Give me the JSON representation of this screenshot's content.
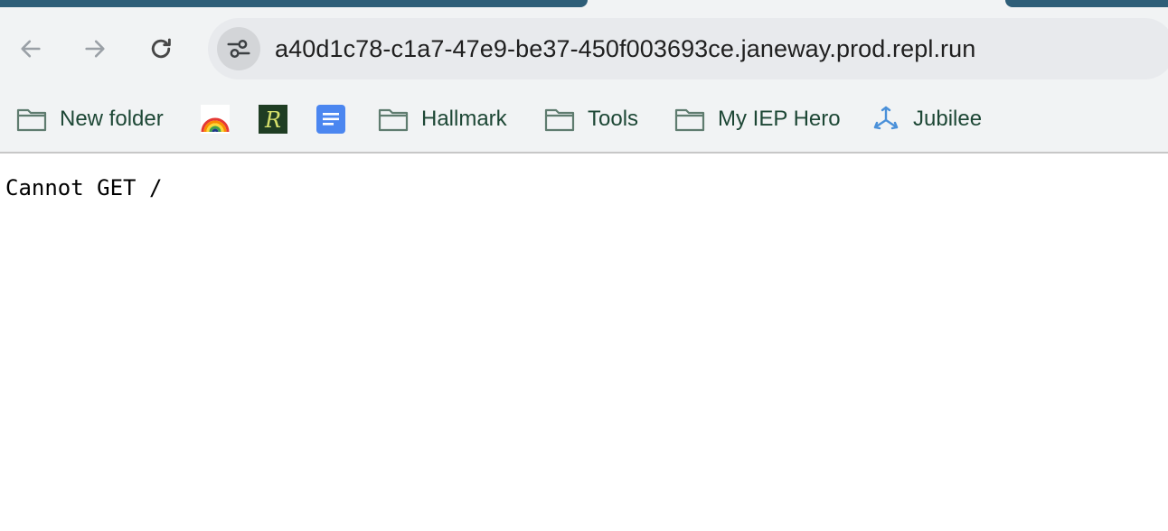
{
  "browser": {
    "url": "a40d1c78-c1a7-47e9-be37-450f003693ce.janeway.prod.repl.run",
    "nav": {
      "back_icon": "arrow-left-icon",
      "forward_icon": "arrow-right-icon",
      "reload_icon": "reload-icon",
      "site_info_icon": "tune-icon"
    },
    "bookmarks": [
      {
        "label": "New folder",
        "icon": "folder-icon"
      },
      {
        "label": "",
        "icon": "rainbow-favicon"
      },
      {
        "label": "",
        "icon": "r-logo-favicon"
      },
      {
        "label": "",
        "icon": "google-docs-favicon"
      },
      {
        "label": "Hallmark",
        "icon": "folder-icon"
      },
      {
        "label": "Tools",
        "icon": "folder-icon"
      },
      {
        "label": "My IEP Hero",
        "icon": "folder-icon"
      },
      {
        "label": "Jubilee",
        "icon": "jubilee-favicon"
      }
    ],
    "colors": {
      "tab_accent": "#2e5e78",
      "toolbar_bg": "#f1f3f4",
      "bookmark_text": "#1d4735"
    }
  },
  "page": {
    "message": "Cannot GET /"
  }
}
